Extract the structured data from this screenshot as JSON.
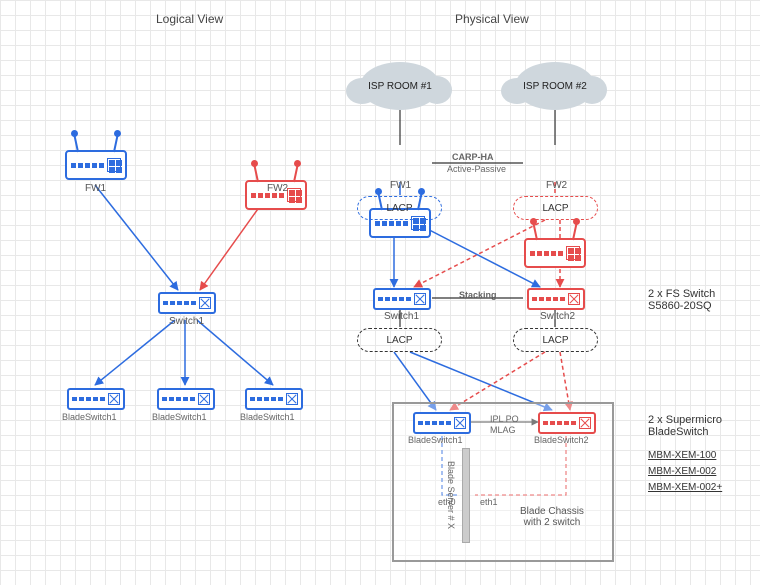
{
  "titles": {
    "logical": "Logical View",
    "physical": "Physical View"
  },
  "clouds": {
    "isp1": "ISP ROOM #1",
    "isp2": "ISP ROOM #2"
  },
  "labels": {
    "fw1": "FW1",
    "fw2": "FW2",
    "switch1": "Switch1",
    "switch2": "Switch2",
    "blade1": "BladeSwitch1",
    "blade2": "BladeSwitch2",
    "lacp": "LACP",
    "carp_ha": "CARP-HA",
    "carp_sub": "Active-Passive",
    "stacking": "Stacking",
    "ipl": "IPL PO",
    "mlag": "MLAG",
    "eth0": "eth0",
    "eth1": "eth1",
    "blade_server": "Blade Server # X",
    "chassis_caption": "Blade Chassis\nwith 2 switch"
  },
  "side": {
    "fs_switch": "2 x FS Switch\nS5860-20SQ",
    "sm_blade": "2 x Supermicro\nBladeSwitch",
    "links": [
      "MBM-XEM-100",
      "MBM-XEM-002",
      "MBM-XEM-002+"
    ]
  },
  "chart_data": {
    "type": "diagram",
    "logical_view": {
      "nodes": [
        {
          "id": "FW1",
          "type": "firewall"
        },
        {
          "id": "FW2",
          "type": "firewall"
        },
        {
          "id": "Switch1",
          "type": "switch"
        },
        {
          "id": "BladeSwitch1_a",
          "type": "bladeswitch"
        },
        {
          "id": "BladeSwitch1_b",
          "type": "bladeswitch"
        },
        {
          "id": "BladeSwitch1_c",
          "type": "bladeswitch"
        }
      ],
      "edges": [
        {
          "from": "FW1",
          "to": "Switch1",
          "style": "solid",
          "color": "blue"
        },
        {
          "from": "FW2",
          "to": "Switch1",
          "style": "solid",
          "color": "red"
        },
        {
          "from": "Switch1",
          "to": "BladeSwitch1_a",
          "style": "solid",
          "color": "blue"
        },
        {
          "from": "Switch1",
          "to": "BladeSwitch1_b",
          "style": "solid",
          "color": "blue"
        },
        {
          "from": "Switch1",
          "to": "BladeSwitch1_c",
          "style": "solid",
          "color": "blue"
        }
      ]
    },
    "physical_view": {
      "nodes": [
        {
          "id": "ISP1",
          "type": "cloud"
        },
        {
          "id": "ISP2",
          "type": "cloud"
        },
        {
          "id": "FW1",
          "type": "firewall"
        },
        {
          "id": "FW2",
          "type": "firewall"
        },
        {
          "id": "Switch1",
          "type": "switch"
        },
        {
          "id": "Switch2",
          "type": "switch"
        },
        {
          "id": "BladeSwitch1",
          "type": "bladeswitch"
        },
        {
          "id": "BladeSwitch2",
          "type": "bladeswitch"
        },
        {
          "id": "BladeServer",
          "type": "server"
        }
      ],
      "edges": [
        {
          "from": "ISP1",
          "to": "FW1",
          "style": "solid",
          "color": "black"
        },
        {
          "from": "ISP2",
          "to": "FW2",
          "style": "solid",
          "color": "black"
        },
        {
          "from": "FW1",
          "to": "FW2",
          "style": "solid",
          "color": "black",
          "label": "CARP-HA Active-Passive"
        },
        {
          "from": "FW1",
          "to": "Switch1",
          "style": "solid",
          "color": "blue",
          "via": "LACP"
        },
        {
          "from": "FW1",
          "to": "Switch2",
          "style": "solid",
          "color": "blue",
          "via": "LACP"
        },
        {
          "from": "FW2",
          "to": "Switch1",
          "style": "dashed",
          "color": "red",
          "via": "LACP"
        },
        {
          "from": "FW2",
          "to": "Switch2",
          "style": "dashed",
          "color": "red",
          "via": "LACP"
        },
        {
          "from": "Switch1",
          "to": "Switch2",
          "style": "solid",
          "color": "black",
          "label": "Stacking"
        },
        {
          "from": "Switch1",
          "to": "BladeSwitch1",
          "style": "solid",
          "color": "blue",
          "via": "LACP"
        },
        {
          "from": "Switch1",
          "to": "BladeSwitch2",
          "style": "solid",
          "color": "blue",
          "via": "LACP"
        },
        {
          "from": "Switch2",
          "to": "BladeSwitch1",
          "style": "dashed",
          "color": "red",
          "via": "LACP"
        },
        {
          "from": "Switch2",
          "to": "BladeSwitch2",
          "style": "dashed",
          "color": "red",
          "via": "LACP"
        },
        {
          "from": "BladeSwitch1",
          "to": "BladeSwitch2",
          "style": "solid",
          "color": "black",
          "label": "IPL PO / MLAG"
        },
        {
          "from": "BladeSwitch1",
          "to": "BladeServer",
          "style": "dashed",
          "color": "blue",
          "label": "eth0"
        },
        {
          "from": "BladeSwitch2",
          "to": "BladeServer",
          "style": "dashed",
          "color": "red",
          "label": "eth1"
        }
      ],
      "annotations": {
        "switches": "2 x FS Switch S5860-20SQ",
        "bladeswitch": "2 x Supermicro BladeSwitch",
        "bladeswitch_models": [
          "MBM-XEM-100",
          "MBM-XEM-002",
          "MBM-XEM-002+"
        ],
        "chassis": "Blade Chassis with 2 switch"
      }
    }
  }
}
